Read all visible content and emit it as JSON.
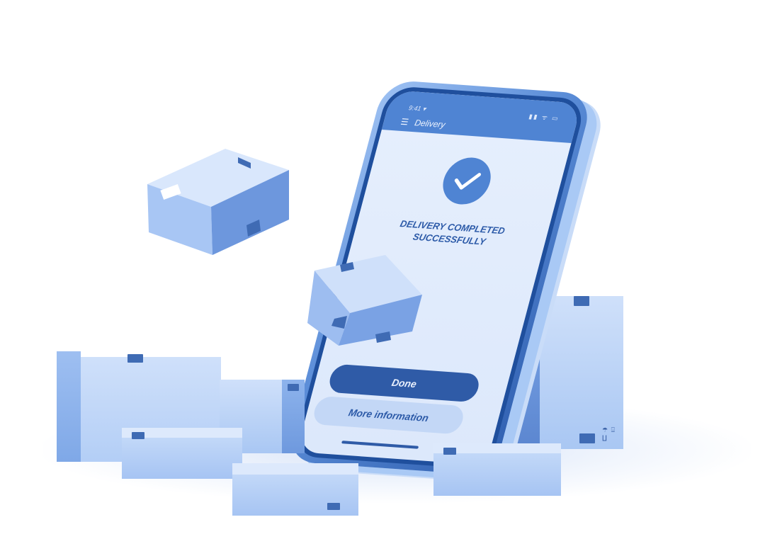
{
  "phone": {
    "status_time": "9:41 ▾",
    "status_icons": "▮▮ ᯤ ▭",
    "menu_icon": "menu-icon",
    "title": "Delivery",
    "check_icon": "check-circle-icon",
    "message_line1": "DELIVERY COMPLETED",
    "message_line2": "SUCCESSFULLY",
    "done_button": "Done",
    "more_button": "More information"
  },
  "box_symbols": "☂ ⍗ ∐",
  "colors": {
    "primary": "#2f5ba7",
    "accent": "#4f84d3",
    "light": "#c3d7f6",
    "screen_bg": "#e6effd"
  }
}
